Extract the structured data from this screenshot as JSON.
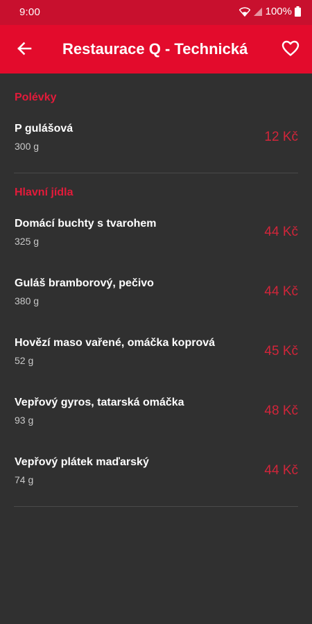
{
  "status_bar": {
    "time": "9:00",
    "battery": "100%",
    "icons": [
      "wifi-icon",
      "signal-icon",
      "battery-icon"
    ]
  },
  "app_bar": {
    "title": "Restaurace Q - Technická",
    "icons": [
      "back-arrow-icon",
      "heart-outline-icon"
    ]
  },
  "colors": {
    "status_bar": "#c8102e",
    "app_bar": "#e30b2c",
    "background": "#303030",
    "accent": "#e31b3a",
    "price": "#d1253a"
  },
  "sections": [
    {
      "title": "Polévky",
      "items": [
        {
          "name": "P gulášová",
          "weight": "300 g",
          "price": "12 Kč"
        }
      ]
    },
    {
      "title": "Hlavní jídla",
      "items": [
        {
          "name": "Domácí buchty s tvarohem",
          "weight": "325 g",
          "price": "44 Kč"
        },
        {
          "name": "Guláš bramborový, pečivo",
          "weight": "380 g",
          "price": "44 Kč"
        },
        {
          "name": "Hovězí maso vařené, omáčka koprová",
          "weight": "52 g",
          "price": "45 Kč"
        },
        {
          "name": "Vepřový gyros, tatarská omáčka",
          "weight": "93 g",
          "price": "48 Kč"
        },
        {
          "name": "Vepřový plátek maďarský",
          "weight": "74 g",
          "price": "44 Kč"
        }
      ]
    }
  ]
}
